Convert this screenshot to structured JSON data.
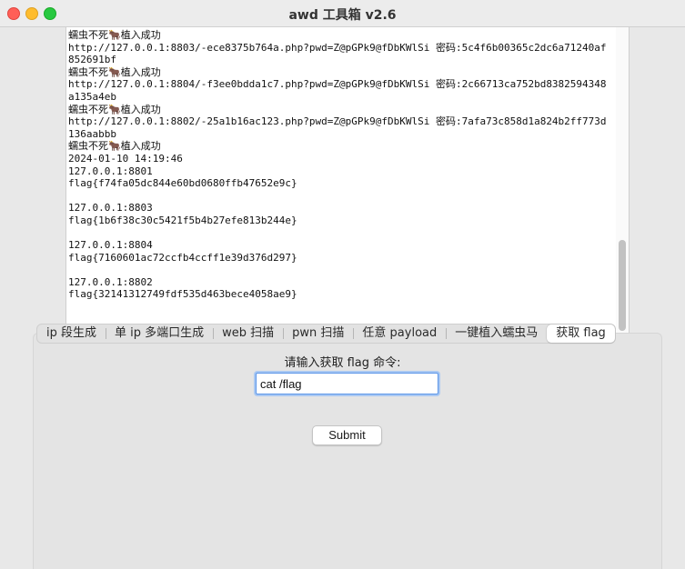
{
  "window": {
    "title": "awd 工具箱 v2.6"
  },
  "output": {
    "lines": [
      "蠕虫不死🐂植入成功",
      "http://127.0.0.1:8803/-ece8375b764a.php?pwd=Z@pGPk9@fDbKWlSi 密码:5c4f6b00365c2dc6a71240af852691bf",
      "蠕虫不死🐂植入成功",
      "http://127.0.0.1:8804/-f3ee0bdda1c7.php?pwd=Z@pGPk9@fDbKWlSi 密码:2c66713ca752bd8382594348a135a4eb",
      "蠕虫不死🐂植入成功",
      "http://127.0.0.1:8802/-25a1b16ac123.php?pwd=Z@pGPk9@fDbKWlSi 密码:7afa73c858d1a824b2ff773d136aabbb",
      "蠕虫不死🐂植入成功",
      "2024-01-10 14:19:46",
      "127.0.0.1:8801",
      "flag{f74fa05dc844e60bd0680ffb47652e9c}",
      "",
      "127.0.0.1:8803",
      "flag{1b6f38c30c5421f5b4b27efe813b244e}",
      "",
      "127.0.0.1:8804",
      "flag{7160601ac72ccfb4ccff1e39d376d297}",
      "",
      "127.0.0.1:8802",
      "flag{32141312749fdf535d463bece4058ae9}"
    ]
  },
  "tabs": [
    {
      "label": "ip 段生成"
    },
    {
      "label": "单 ip 多端口生成"
    },
    {
      "label": "web 扫描"
    },
    {
      "label": "pwn 扫描"
    },
    {
      "label": "任意 payload"
    },
    {
      "label": "一键植入蠕虫马"
    },
    {
      "label": "获取 flag"
    }
  ],
  "active_tab": "获取 flag",
  "form": {
    "prompt": "请输入获取 flag 命令:",
    "command_value": "cat /flag",
    "submit_label": "Submit"
  },
  "colors": {
    "close": "#ff5f57",
    "minimize": "#febc2e",
    "zoom": "#28c840",
    "focus_ring": "#5b95e8"
  }
}
